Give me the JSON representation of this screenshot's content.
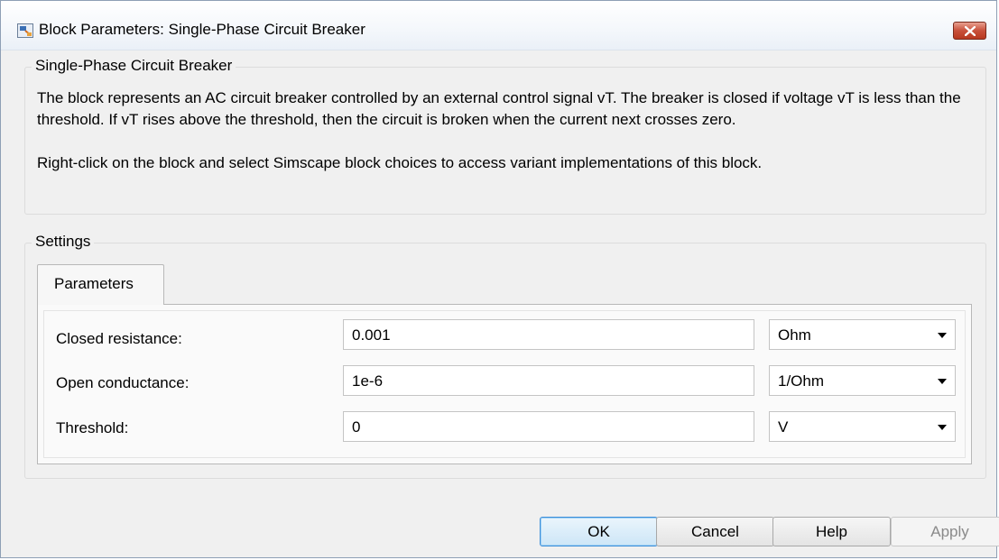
{
  "window": {
    "title": "Block Parameters: Single-Phase Circuit Breaker"
  },
  "description_group": {
    "legend": "Single-Phase Circuit Breaker",
    "paragraph1": "The block represents an AC circuit breaker controlled by an external control signal vT. The breaker is closed if voltage vT is less than the threshold. If vT rises above the threshold, then the circuit is broken when the current next crosses zero.",
    "paragraph2": "Right-click on the block and select Simscape block choices to access variant implementations of this block."
  },
  "settings_group": {
    "legend": "Settings",
    "tab_label": "Parameters",
    "parameters": [
      {
        "label": "Closed resistance:",
        "value": "0.001",
        "unit": "Ohm"
      },
      {
        "label": "Open conductance:",
        "value": "1e-6",
        "unit": "1/Ohm"
      },
      {
        "label": "Threshold:",
        "value": "0",
        "unit": "V"
      }
    ]
  },
  "buttons": {
    "ok": "OK",
    "cancel": "Cancel",
    "help": "Help",
    "apply": "Apply"
  }
}
